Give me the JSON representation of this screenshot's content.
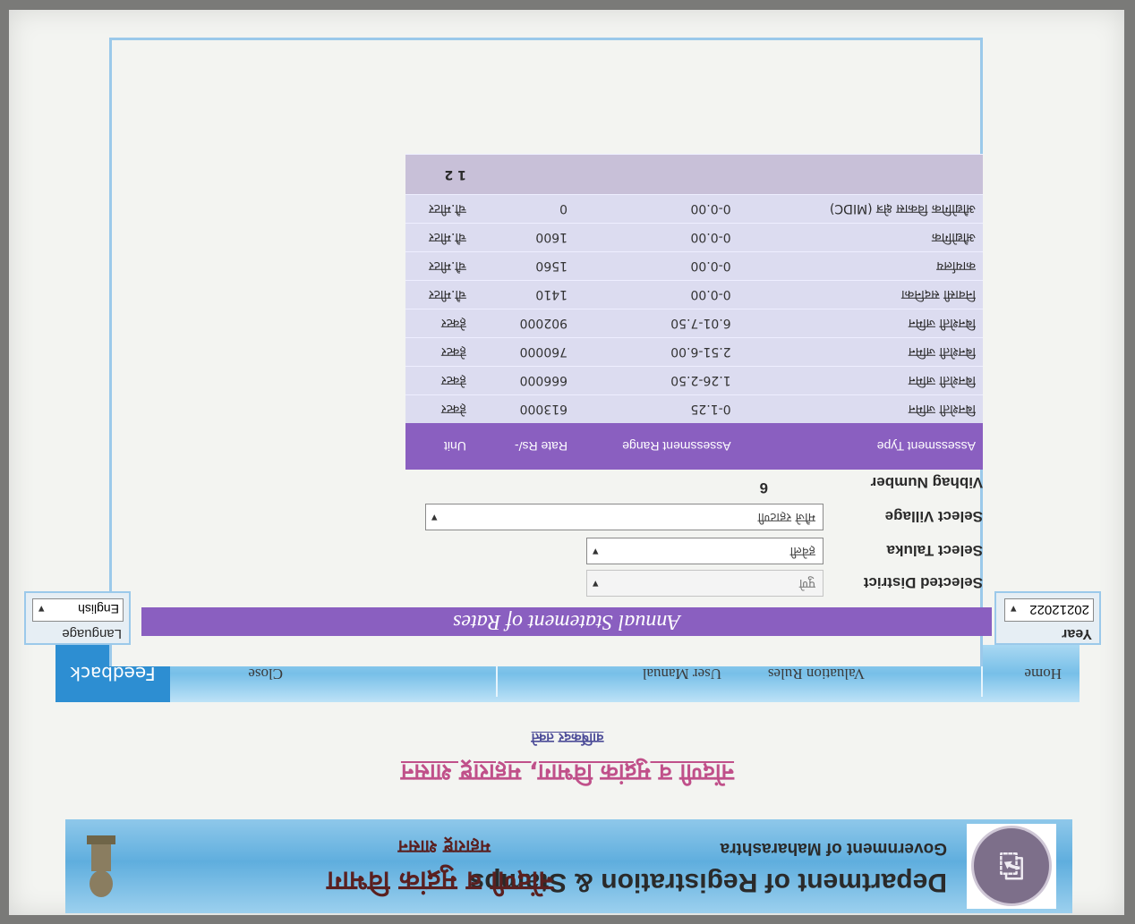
{
  "header": {
    "department_en": "Department of Registration & Stamps",
    "government_en": "Government of Maharashtra",
    "department_mr": "नोंदणी व मुद्रांक विभाग",
    "government_mr": "महाराष्ट्र शासन"
  },
  "office_title": "नोंदणी व मुद्रांक विभाग, महाराष्ट्र शासन",
  "subtitle": "वार्षिकदर तक्ते",
  "nav": {
    "home": "Home",
    "valuation_rules": "Valuation Rules",
    "user_manual": "User Manual",
    "close": "Close",
    "feedback": "Feedback"
  },
  "panel": {
    "title": "Annual Statement of Rates",
    "year_label": "Year",
    "year_value": "20212022",
    "language_label": "Language",
    "language_value": "English"
  },
  "form": {
    "district_label": "Selected District",
    "district_value": "पुणे",
    "taluka_label": "Select Taluka",
    "taluka_value": "हवेली",
    "village_label": "Select Village",
    "village_value": "मौजे रहाटणी",
    "vibhag_label": "Vibhag Number",
    "vibhag_value": "6"
  },
  "table": {
    "headers": {
      "type": "Assessment Type",
      "range": "Assessment Range",
      "rate": "Rate Rs/-",
      "unit": "Unit"
    },
    "rows": [
      {
        "type": "बिनशेती जमिन",
        "range": "0-1.25",
        "rate": "613000",
        "unit": "हेक्टर"
      },
      {
        "type": "बिनशेती जमिन",
        "range": "1.26-2.50",
        "rate": "666000",
        "unit": "हेक्टर"
      },
      {
        "type": "बिनशेती जमिन",
        "range": "2.51-6.00",
        "rate": "760000",
        "unit": "हेक्टर"
      },
      {
        "type": "बिनशेती जमिन",
        "range": "6.01-7.50",
        "rate": "902000",
        "unit": "हेक्टर"
      },
      {
        "type": "निवासी सदनिका",
        "range": "0-0.00",
        "rate": "1410",
        "unit": "चौ.मीटर"
      },
      {
        "type": "कार्यालय",
        "range": "0-0.00",
        "rate": "1560",
        "unit": "चौ.मीटर"
      },
      {
        "type": "औद्योगिक",
        "range": "0-0.00",
        "rate": "1600",
        "unit": "चौ.मीटर"
      },
      {
        "type": "औद्योगिक विकास क्षेत्र (MIDC)",
        "range": "0-0.00",
        "rate": "0",
        "unit": "चौ.मीटर"
      }
    ],
    "pager": "1 2"
  },
  "colors": {
    "accent_purple": "#8a5fc0",
    "nav_blue": "#77bfe8",
    "feedback_blue": "#2d8ed2",
    "title_pink": "#c0508a"
  }
}
